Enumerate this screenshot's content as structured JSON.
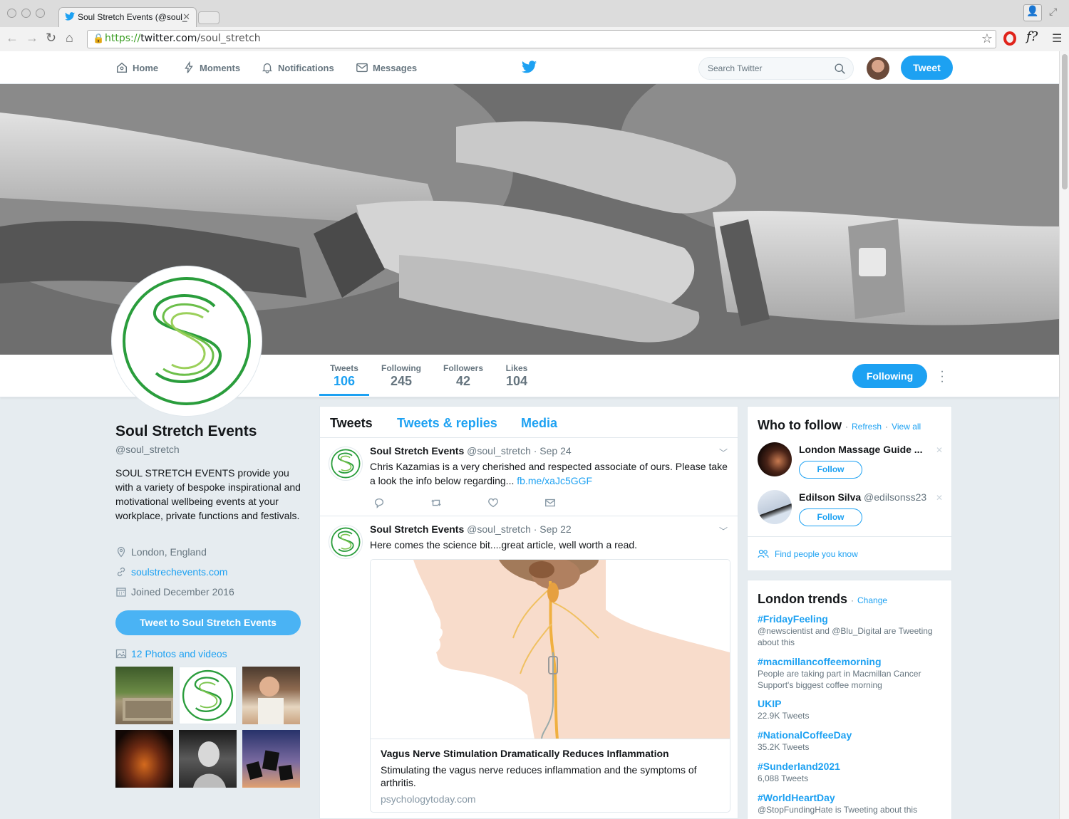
{
  "browser": {
    "tab_title": "Soul Stretch Events (@soul_",
    "url_scheme": "https://",
    "url_host": "twitter.com",
    "url_path": "/soul_stretch"
  },
  "nav": {
    "home": "Home",
    "moments": "Moments",
    "notifications": "Notifications",
    "messages": "Messages",
    "search_placeholder": "Search Twitter",
    "tweet_button": "Tweet"
  },
  "stats": [
    {
      "label": "Tweets",
      "value": "106"
    },
    {
      "label": "Following",
      "value": "245"
    },
    {
      "label": "Followers",
      "value": "42"
    },
    {
      "label": "Likes",
      "value": "104"
    }
  ],
  "following_button": "Following",
  "profile": {
    "name": "Soul Stretch Events",
    "handle": "@soul_stretch",
    "bio": "SOUL STRETCH EVENTS provide you with a variety of bespoke inspirational and motivational wellbeing events at your workplace, private functions and festivals.",
    "location": "London, England",
    "website": "soulstrechevents.com",
    "joined": "Joined December 2016",
    "tweet_to": "Tweet to Soul Stretch Events",
    "photos": "12 Photos and videos"
  },
  "timeline": {
    "tabs": [
      "Tweets",
      "Tweets & replies",
      "Media"
    ],
    "tweets": [
      {
        "name": "Soul Stretch Events",
        "meta": "@soul_stretch · Sep 24",
        "text": "Chris Kazamias is a very cherished and respected associate of ours. Please take a look the info below regarding... ",
        "link": "fb.me/xaJc5GGF"
      },
      {
        "name": "Soul Stretch Events",
        "meta": "@soul_stretch · Sep 22",
        "text": "Here comes the science bit....great article, well worth a read.",
        "card": {
          "title": "Vagus Nerve Stimulation Dramatically Reduces Inflammation",
          "description": "Stimulating the vagus nerve reduces inflammation and the symptoms of arthritis.",
          "domain": "psychologytoday.com"
        }
      }
    ]
  },
  "who_to_follow": {
    "title": "Who to follow",
    "refresh": "Refresh",
    "view_all": "View all",
    "sep": "·",
    "users": [
      {
        "name": "London Massage Guide ...",
        "handle": "",
        "follow": "Follow"
      },
      {
        "name": "Edilson Silva",
        "handle": "@edilsonss23",
        "follow": "Follow"
      }
    ],
    "find_people": "Find people you know"
  },
  "trends": {
    "title": "London trends",
    "change": "Change",
    "items": [
      {
        "name": "#FridayFeeling",
        "desc": "@newscientist and @Blu_Digital are Tweeting about this"
      },
      {
        "name": "#macmillancoffeemorning",
        "desc": "People are taking part in Macmillan Cancer Support's biggest coffee morning"
      },
      {
        "name": "UKIP",
        "desc": "22.9K Tweets"
      },
      {
        "name": "#NationalCoffeeDay",
        "desc": "35.2K Tweets"
      },
      {
        "name": "#Sunderland2021",
        "desc": "6,088 Tweets"
      },
      {
        "name": "#WorldHeartDay",
        "desc": "@StopFundingHate is Tweeting about this"
      }
    ]
  },
  "colors": {
    "accent": "#1da1f2",
    "brand_green": "#2a9d3c"
  }
}
